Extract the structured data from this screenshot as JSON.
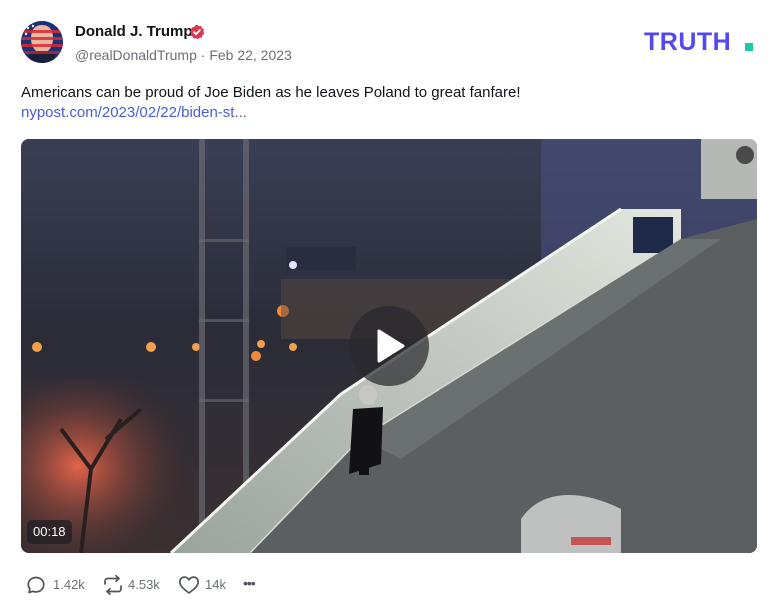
{
  "post": {
    "author": {
      "display_name": "Donald J. Trump",
      "verified": true,
      "handle": "@realDonaldTrump",
      "separator": "·",
      "date": "Feb 22, 2023"
    },
    "brand": {
      "text": "TRUTH.",
      "color": "#5448ee",
      "dot_color": "#20c9a5"
    },
    "text": "Americans can be proud of Joe Biden as he leaves Poland to great fanfare!",
    "link": {
      "label": "nypost.com/2023/02/22/biden-st..."
    },
    "video": {
      "duration": "00:18",
      "icon": "play-icon"
    },
    "actions": {
      "replies": {
        "icon": "reply-icon",
        "count": "1.42k"
      },
      "retruths": {
        "icon": "retruth-icon",
        "count": "4.53k"
      },
      "likes": {
        "icon": "heart-icon",
        "count": "14k"
      },
      "more": {
        "icon": "more-icon",
        "label": "•••"
      }
    },
    "colors": {
      "text": "#0f1419",
      "secondary": "#6b6f76",
      "link": "#4a5cd6",
      "verified_badge": "#e0364f"
    }
  }
}
